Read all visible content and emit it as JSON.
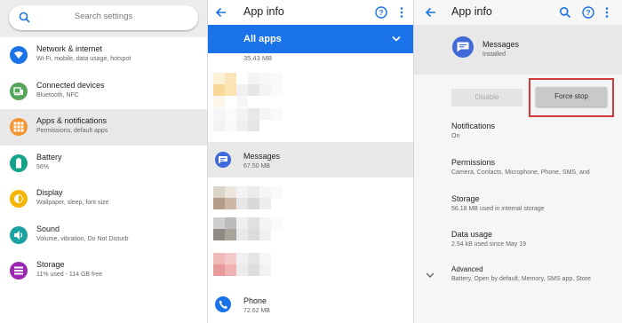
{
  "settings": {
    "search_placeholder": "Search settings",
    "items": [
      {
        "title": "Network & internet",
        "subtitle": "Wi-Fi, mobile, data usage, hotspot",
        "color": "#1a73e8",
        "icon": "wifi-icon"
      },
      {
        "title": "Connected devices",
        "subtitle": "Bluetooth, NFC",
        "color": "#57a55a",
        "icon": "devices-icon"
      },
      {
        "title": "Apps & notifications",
        "subtitle": "Permissions, default apps",
        "color": "#f29430",
        "icon": "apps-icon"
      },
      {
        "title": "Battery",
        "subtitle": "56%",
        "color": "#14a38b",
        "icon": "battery-icon"
      },
      {
        "title": "Display",
        "subtitle": "Wallpaper, sleep, font size",
        "color": "#f5b400",
        "icon": "brightness-icon"
      },
      {
        "title": "Sound",
        "subtitle": "Volume, vibration, Do Not Disturb",
        "color": "#1ba3a3",
        "icon": "volume-icon"
      },
      {
        "title": "Storage",
        "subtitle": "11% used - 114 GB free",
        "color": "#9c27b0",
        "icon": "storage-icon"
      }
    ]
  },
  "app_list": {
    "title": "App info",
    "filter_label": "All apps",
    "top_size": "35.43 MB",
    "messages": {
      "name": "Messages",
      "size": "67.50 MB"
    },
    "phone": {
      "name": "Phone",
      "size": "72.62 MB"
    },
    "accent": "#1a73e8"
  },
  "app_info": {
    "title": "App info",
    "app_name": "Messages",
    "app_status": "Installed",
    "disable_label": "Disable",
    "force_stop_label": "Force stop",
    "highlight_color": "#d03a3a",
    "prefs": [
      {
        "title": "Notifications",
        "subtitle": "On"
      },
      {
        "title": "Permissions",
        "subtitle": "Camera, Contacts, Microphone, Phone, SMS, and"
      },
      {
        "title": "Storage",
        "subtitle": "56.18 MB used in internal storage"
      },
      {
        "title": "Data usage",
        "subtitle": "2.54 kB used since May 19"
      },
      {
        "title": "Advanced",
        "subtitle": "Battery, Open by default, Memory, SMS app, Store"
      }
    ]
  }
}
